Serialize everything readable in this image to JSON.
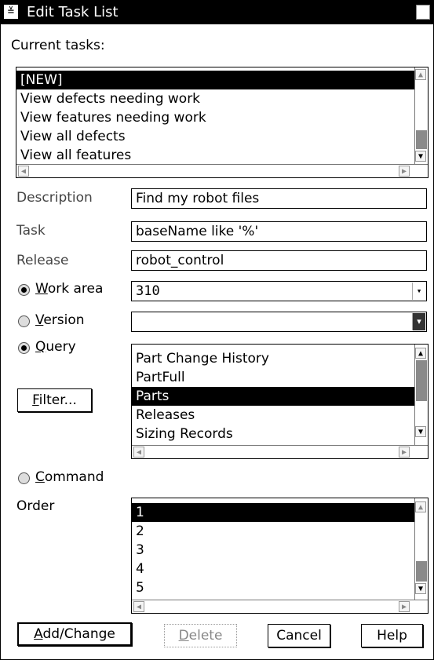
{
  "window": {
    "title": "Edit Task List"
  },
  "current_tasks": {
    "label": "Current tasks:",
    "items": [
      "[NEW]",
      "View defects needing work",
      "View features needing work",
      "View all defects",
      "View all features"
    ],
    "selected_index": 0
  },
  "fields": {
    "description": {
      "label": "Description",
      "value": "Find my robot files"
    },
    "task": {
      "label": "Task",
      "value": "baseName like '%'"
    },
    "release": {
      "label": "Release",
      "value": "robot_control"
    },
    "work_area": {
      "label": "Work area",
      "value": "310",
      "checked": true
    },
    "version": {
      "label": "Version",
      "value": "",
      "checked": false
    }
  },
  "query": {
    "label": "Query",
    "checked": true,
    "filter_label": "Filter...",
    "items": [
      "Part Change History",
      "PartFull",
      "Parts",
      "Releases",
      "Sizing Records"
    ],
    "selected_index": 2
  },
  "command": {
    "label": "Command",
    "checked": false
  },
  "order": {
    "label": "Order",
    "items": [
      "1",
      "2",
      "3",
      "4",
      "5"
    ],
    "selected_index": 0
  },
  "buttons": {
    "add_change": "Add/Change",
    "delete": "Delete",
    "cancel": "Cancel",
    "help": "Help"
  },
  "icons": {
    "system_menu": "system-menu-icon",
    "maximize": "maximize-icon",
    "scroll_up": "arrow-up-icon",
    "scroll_down": "arrow-down-icon",
    "scroll_left": "arrow-left-icon",
    "scroll_right": "arrow-right-icon",
    "dropdown": "dropdown-icon"
  }
}
